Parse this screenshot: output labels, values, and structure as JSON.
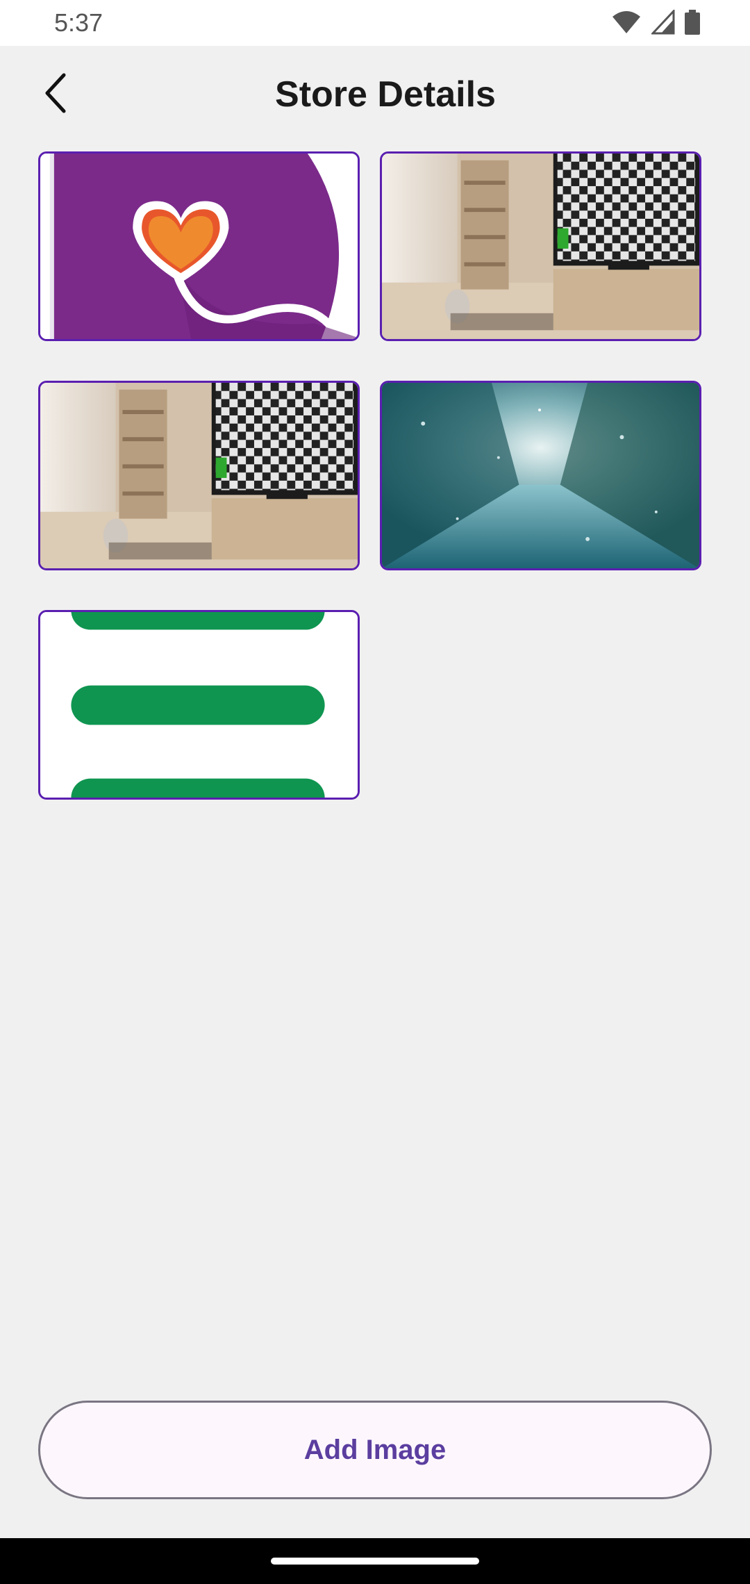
{
  "status_bar": {
    "time": "5:37",
    "icons": [
      "wifi-icon",
      "cellular-signal-icon",
      "battery-icon"
    ]
  },
  "header": {
    "title": "Store Details",
    "back_icon": "arrow-back-icon"
  },
  "gallery": {
    "images": [
      {
        "name": "heart-logo-image",
        "description": "purple background with orange heart logo"
      },
      {
        "name": "living-room-tv-image",
        "description": "room with bookshelf, cat and TV showing checkerboard"
      },
      {
        "name": "living-room-tv-image",
        "description": "room with bookshelf, cat and TV showing checkerboard"
      },
      {
        "name": "rainy-city-street-image",
        "description": "blurred city street seen through rainy window"
      },
      {
        "name": "green-bars-image",
        "description": "green horizontal bars on white"
      }
    ]
  },
  "actions": {
    "add_image_label": "Add Image"
  },
  "colors": {
    "background": "#f1f0f1",
    "tile_border": "#5a1fb0",
    "button_text": "#5b3e9f",
    "button_bg": "#fdf7fd"
  }
}
